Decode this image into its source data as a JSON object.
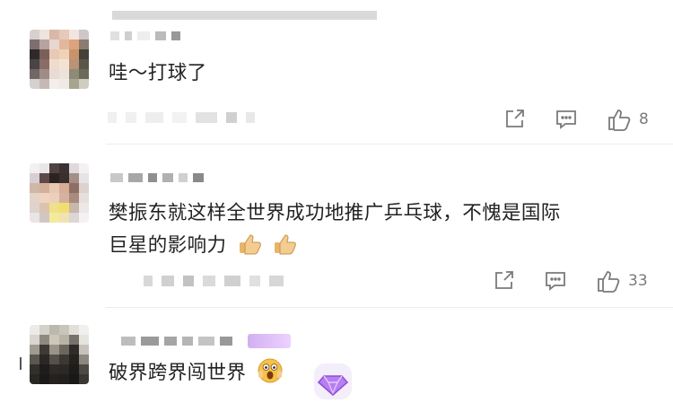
{
  "comments": [
    {
      "text": "哇～打球了",
      "likes": null,
      "like_count": "8"
    },
    {
      "text_line1": "樊振东就这样全世界成功地推广乒乓球，不愧是国际",
      "text_line2": "巨星的影响力",
      "like_count": "33"
    },
    {
      "text": "破界跨界闯世界"
    }
  ],
  "icons": {
    "share": "share-icon",
    "comment": "comment-icon",
    "like": "thumbs-up-icon",
    "emoji_thumb": "thumbs-up-emoji",
    "emoji_shock": "shocked-face-emoji",
    "gem": "gem-badge-icon"
  },
  "colors": {
    "text": "#222222",
    "meta": "#7a7a7a",
    "divider": "#ececec",
    "badge": "#c9a2ef"
  }
}
